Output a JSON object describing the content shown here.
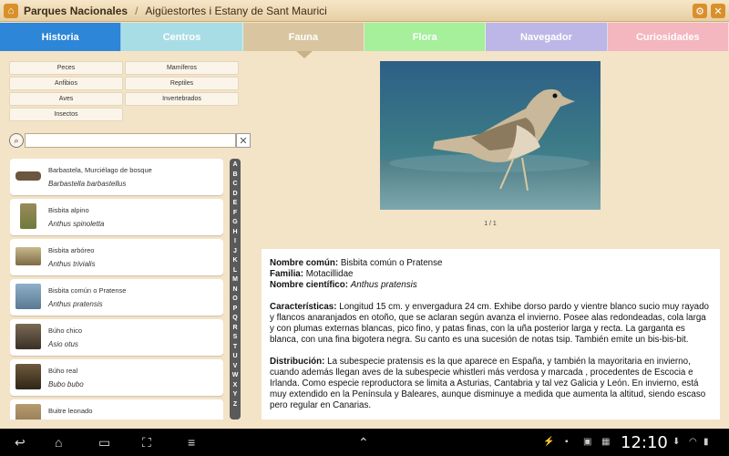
{
  "actionbar": {
    "app_title": "Parques Nacionales",
    "separator": "/",
    "breadcrumb": "Aigüestortes i Estany de Sant Maurici"
  },
  "tabs": [
    {
      "label": "Historia",
      "color": "#2e86d8"
    },
    {
      "label": "Centros",
      "color": "#a9dde6"
    },
    {
      "label": "Fauna",
      "color": "#d9c6a0",
      "active": true
    },
    {
      "label": "Flora",
      "color": "#a6ef9b"
    },
    {
      "label": "Navegador",
      "color": "#bcb7e6"
    },
    {
      "label": "Curiosidades",
      "color": "#f4b6bf"
    }
  ],
  "categories": [
    "Peces",
    "Mamíferos",
    "Anfibios",
    "Reptiles",
    "Aves",
    "Invertebrados",
    "Insectos"
  ],
  "search": {
    "value": "",
    "placeholder": ""
  },
  "species": [
    {
      "common": "Barbastela, Murciélago de bosque",
      "scientific": "Barbastella barbastellus"
    },
    {
      "common": "Bisbita alpino",
      "scientific": "Anthus spinoletta"
    },
    {
      "common": "Bisbita arbóreo",
      "scientific": "Anthus trivialis"
    },
    {
      "common": "Bisbita común o Pratense",
      "scientific": "Anthus pratensis"
    },
    {
      "common": "Búho chico",
      "scientific": "Asio otus"
    },
    {
      "common": "Búho real",
      "scientific": "Bubo bubo"
    },
    {
      "common": "Buitre leonado",
      "scientific": ""
    }
  ],
  "alphabet": [
    "A",
    "B",
    "C",
    "D",
    "E",
    "F",
    "G",
    "H",
    "I",
    "J",
    "K",
    "L",
    "M",
    "N",
    "O",
    "P",
    "Q",
    "R",
    "S",
    "T",
    "U",
    "V",
    "W",
    "X",
    "Y",
    "Z"
  ],
  "photo": {
    "pager": "1 / 1"
  },
  "detail": {
    "common_label": "Nombre común:",
    "common_value": " Bisbita común o Pratense",
    "family_label": "Familia:",
    "family_value": " Motacillidae",
    "sci_label": "Nombre científico:",
    "sci_value": "Anthus pratensis",
    "char_label": "Características:",
    "char_text": " Longitud 15 cm. y envergadura 24 cm. Exhibe dorso pardo y vientre blanco sucio muy rayado y flancos anaranjados en otoño, que se aclaran según avanza el invierno. Posee alas redondeadas, cola larga y con plumas externas blancas, pico fino, y patas finas, con la uña posterior larga y recta. La garganta es blanca, con una fina bigotera negra. Su canto es una sucesión de notas tsip. También emite un bis-bis-bit.",
    "dist_label": "Distribución:",
    "dist_text": " La subespecie pratensis es la que aparece en España, y también la mayoritaria en invierno, cuando además llegan aves de la subespecie whistleri  más verdosa y marcada , procedentes de Escocia e Irlanda. Como especie reproductora se limita a Asturias, Cantabria y tal vez Galicia y León. En invierno, está muy extendido en la Península y Baleares, aunque disminuye a medida que aumenta la altitud, siendo escaso pero regular en Canarias."
  },
  "statusbar": {
    "time": "12:10"
  }
}
